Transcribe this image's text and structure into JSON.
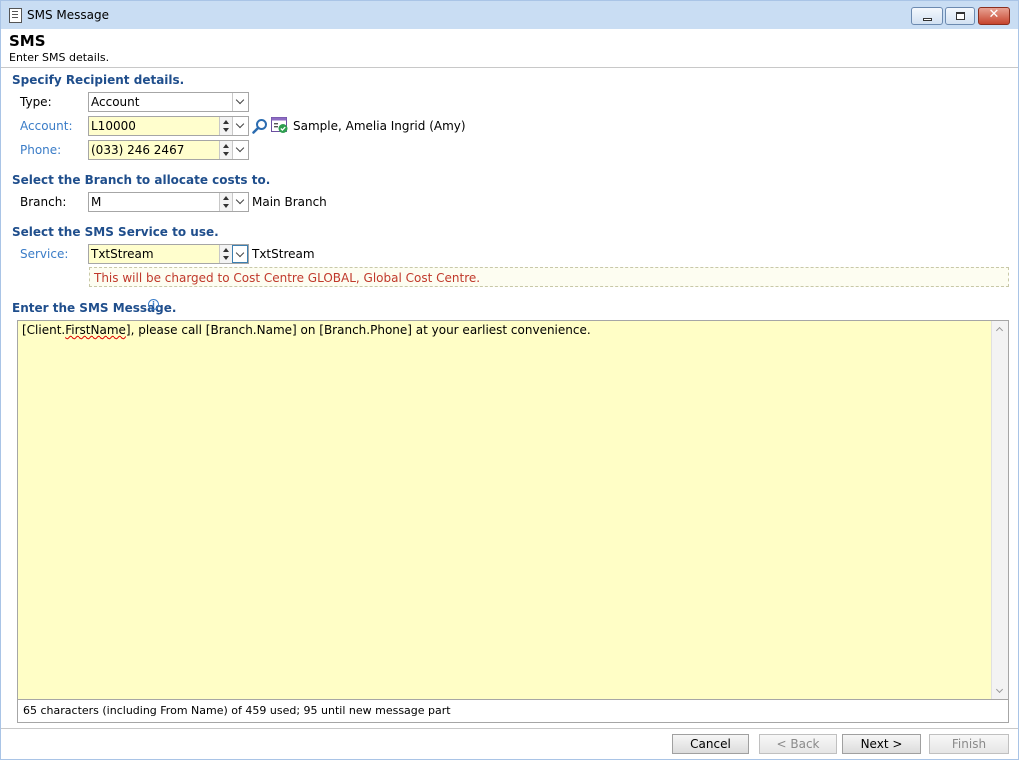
{
  "window": {
    "title": "SMS Message",
    "icon": "document-icon",
    "controls": [
      "minimize-icon",
      "maximize-icon",
      "close-icon"
    ],
    "close_glyph": "✕"
  },
  "header": {
    "title": "SMS",
    "subtitle": "Enter SMS details."
  },
  "recipient": {
    "section_title": "Specify Recipient details.",
    "type_label": "Type:",
    "type_value": "Account",
    "account_label": "Account:",
    "account_value": "L10000",
    "account_name": "Sample, Amelia Ingrid (Amy)",
    "phone_label": "Phone:",
    "phone_value": "(033) 246 2467"
  },
  "branch": {
    "section_title": "Select the Branch to allocate costs to.",
    "label": "Branch:",
    "value": "M",
    "name": "Main Branch"
  },
  "service": {
    "section_title": "Select the SMS Service to use.",
    "label": "Service:",
    "value": "TxtStream",
    "name": "TxtStream",
    "notice": "This will be charged to Cost Centre GLOBAL, Global Cost Centre."
  },
  "message": {
    "section_title": "Enter the SMS Message.",
    "text_part1": "[Client.",
    "text_misspelled": "FirstName",
    "text_part2": "], please call [Branch.Name] on [Branch.Phone] at your earliest convenience.",
    "counter": "65 characters (including From Name) of 459 used; 95 until new message part"
  },
  "buttons": {
    "cancel": "Cancel",
    "back": "< Back",
    "next": "Next >",
    "finish": "Finish"
  },
  "colors": {
    "section_heading": "#1f4e8c",
    "link_label": "#3a7cc7",
    "notice_text": "#c0392b",
    "input_highlight": "#fffecd",
    "message_background": "#fffec6"
  }
}
